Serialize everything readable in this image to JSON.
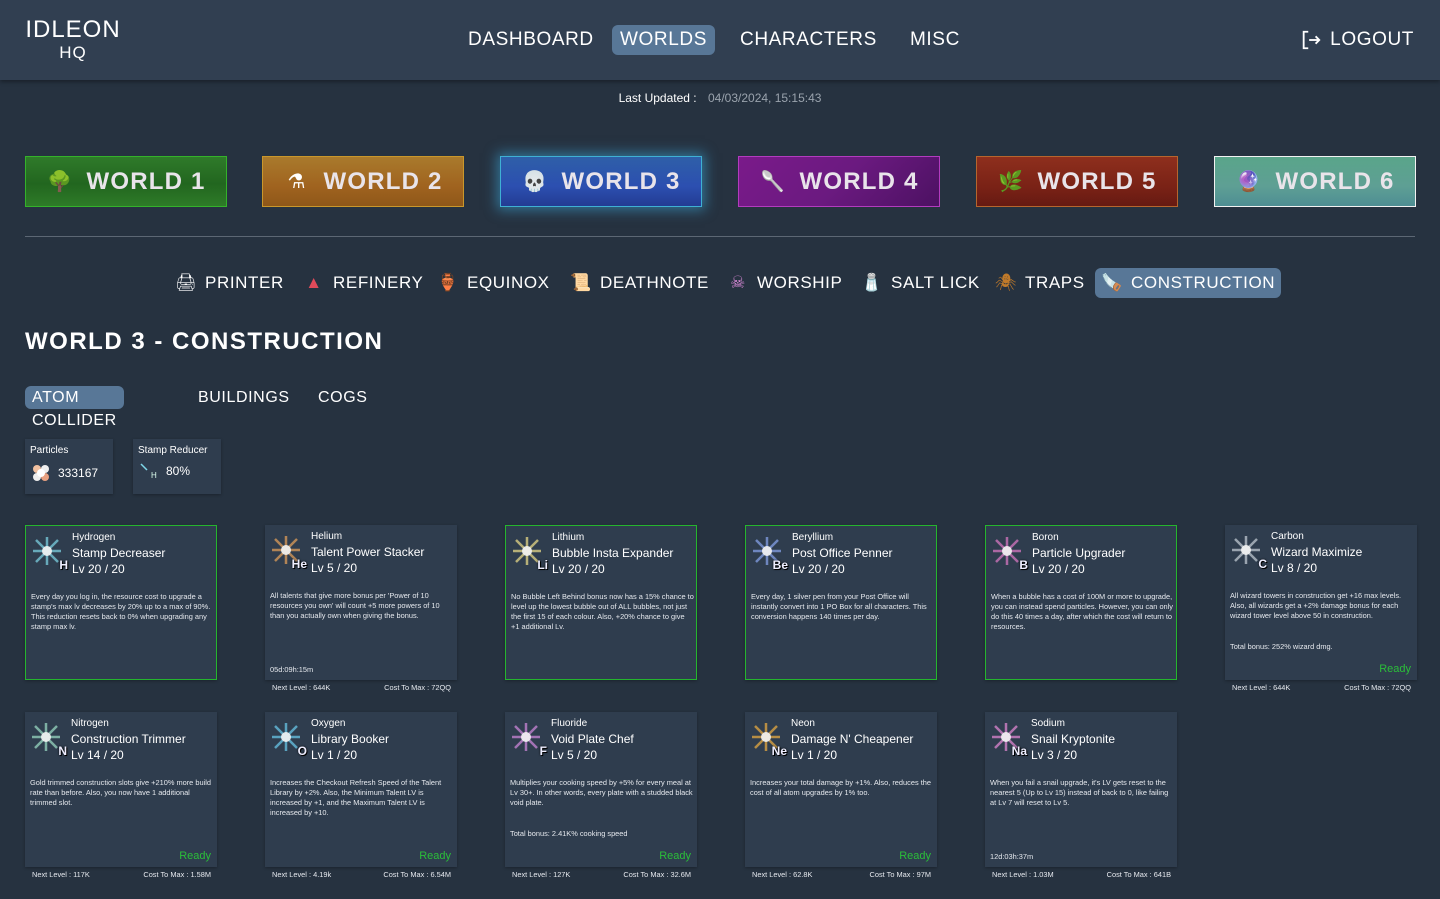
{
  "header": {
    "logo_line1": "IDLEON",
    "logo_line2": "HQ",
    "nav": [
      {
        "label": "DASHBOARD",
        "active": false
      },
      {
        "label": "WORLDS",
        "active": true
      },
      {
        "label": "CHARACTERS",
        "active": false
      },
      {
        "label": "MISC",
        "active": false
      }
    ],
    "logout_label": "LOGOUT",
    "logout_icon": "logout-icon"
  },
  "last_updated": {
    "label": "Last Updated :",
    "value": "04/03/2024, 15:15:43"
  },
  "worlds": [
    {
      "label": "WORLD 1",
      "icon": "tree-anvil-icon",
      "active": false
    },
    {
      "label": "WORLD 2",
      "icon": "alchemy-icon",
      "active": false
    },
    {
      "label": "WORLD 3",
      "icon": "saw-skull-icon",
      "active": true
    },
    {
      "label": "WORLD 4",
      "icon": "ladle-icon",
      "active": false
    },
    {
      "label": "WORLD 5",
      "icon": "sprout-icon",
      "active": false
    },
    {
      "label": "WORLD 6",
      "icon": "orb-icon",
      "active": false
    }
  ],
  "subnav": [
    {
      "label": "PRINTER",
      "icon": "printer-icon",
      "active": false
    },
    {
      "label": "REFINERY",
      "icon": "refinery-icon",
      "active": false
    },
    {
      "label": "EQUINOX",
      "icon": "equinox-icon",
      "active": false
    },
    {
      "label": "DEATHNOTE",
      "icon": "deathnote-icon",
      "active": false
    },
    {
      "label": "WORSHIP",
      "icon": "worship-skull-icon",
      "active": false
    },
    {
      "label": "SALT LICK",
      "icon": "salt-lick-icon",
      "active": false
    },
    {
      "label": "TRAPS",
      "icon": "spider-icon",
      "active": false
    },
    {
      "label": "CONSTRUCTION",
      "icon": "saw-icon",
      "active": true
    }
  ],
  "page_title": "WORLD 3 - CONSTRUCTION",
  "tabs": [
    {
      "label": "ATOM COLLIDER",
      "active": true
    },
    {
      "label": "BUILDINGS",
      "active": false
    },
    {
      "label": "COGS",
      "active": false
    }
  ],
  "stats": [
    {
      "label": "Particles",
      "value": "333167",
      "icon": "particles-icon"
    },
    {
      "label": "Stamp Reducer",
      "value": "80%",
      "icon": "hydrogen-icon"
    }
  ],
  "atoms": [
    {
      "element": "Hydrogen",
      "symbol": "H",
      "name": "Stamp Decreaser",
      "level": "Lv 20 / 20",
      "maxed": true,
      "color": "#7fd8e8",
      "description": "Every day you log in, the resource cost to upgrade a stamp's max lv decreases by 20% up to a max of 90%. This reduction resets back to 0% when upgrading any stamp max lv.",
      "extra": "",
      "timer": "",
      "ready": "",
      "next_level": "",
      "cost_to_max": ""
    },
    {
      "element": "Helium",
      "symbol": "He",
      "name": "Talent Power Stacker",
      "level": "Lv 5 / 20",
      "maxed": false,
      "color": "#e8a35a",
      "description": "All talents that give more bonus per 'Power of 10 resources you own' will count +5 more powers of 10 than you actually own when giving the bonus.",
      "extra": "",
      "timer": "05d:09h:15m",
      "ready": "",
      "next_level": "Next Level : 644K",
      "cost_to_max": "Cost To Max : 72QQ"
    },
    {
      "element": "Lithium",
      "symbol": "Li",
      "name": "Bubble Insta Expander",
      "level": "Lv 20 / 20",
      "maxed": true,
      "color": "#f0e08a",
      "description": "No Bubble Left Behind bonus now has a 15% chance to level up the lowest bubble out of ALL bubbles, not just the first 15 of each colour. Also, +20% chance to give +1 additional Lv.",
      "extra": "",
      "timer": "",
      "ready": "",
      "next_level": "",
      "cost_to_max": ""
    },
    {
      "element": "Beryllium",
      "symbol": "Be",
      "name": "Post Office Penner",
      "level": "Lv 20 / 20",
      "maxed": true,
      "color": "#8aa6f0",
      "description": "Every day, 1 silver pen from your Post Office will instantly convert into 1 PO Box for all characters. This conversion happens 140 times per day.",
      "extra": "",
      "timer": "",
      "ready": "",
      "next_level": "",
      "cost_to_max": ""
    },
    {
      "element": "Boron",
      "symbol": "B",
      "name": "Particle Upgrader",
      "level": "Lv 20 / 20",
      "maxed": true,
      "color": "#e07ac8",
      "description": "When a bubble has a cost of 100M or more to upgrade, you can instead spend particles. However, you can only do this 40 times a day, after which the cost will return to resources.",
      "extra": "",
      "timer": "",
      "ready": "",
      "next_level": "",
      "cost_to_max": ""
    },
    {
      "element": "Carbon",
      "symbol": "C",
      "name": "Wizard Maximize",
      "level": "Lv 8 / 20",
      "maxed": false,
      "color": "#c8d0d8",
      "description": "All wizard towers in construction get +16 max levels. Also, all wizards get a +2% damage bonus for each wizard tower level above 50 in construction.",
      "extra": "Total bonus: 252% wizard dmg.",
      "timer": "",
      "ready": "Ready",
      "next_level": "Next Level : 644K",
      "cost_to_max": "Cost To Max : 72QQ"
    },
    {
      "element": "Nitrogen",
      "symbol": "N",
      "name": "Construction Trimmer",
      "level": "Lv 14 / 20",
      "maxed": false,
      "color": "#9fe0c8",
      "description": "Gold trimmed construction slots give +210% more build rate than before. Also, you now have 1 additional trimmed slot.",
      "extra": "",
      "timer": "",
      "ready": "Ready",
      "next_level": "Next Level : 117K",
      "cost_to_max": "Cost To Max : 1.58M"
    },
    {
      "element": "Oxygen",
      "symbol": "O",
      "name": "Library Booker",
      "level": "Lv 1 / 20",
      "maxed": false,
      "color": "#6ccdf0",
      "description": "Increases the Checkout Refresh Speed of the Talent Library by +2%. Also, the Minimum Talent LV is increased by +1, and the Maximum Talent LV is increased by +10.",
      "extra": "",
      "timer": "",
      "ready": "Ready",
      "next_level": "Next Level : 4.19k",
      "cost_to_max": "Cost To Max : 6.54M"
    },
    {
      "element": "Fluoride",
      "symbol": "F",
      "name": "Void Plate Chef",
      "level": "Lv 5 / 20",
      "maxed": false,
      "color": "#d48ae0",
      "description": "Multiplies your cooking speed by +5% for every meal at Lv 30+. In other words, every plate with a studded black void plate.",
      "extra": "Total bonus: 2.41K% cooking speed",
      "timer": "",
      "ready": "Ready",
      "next_level": "Next Level : 127K",
      "cost_to_max": "Cost To Max : 32.6M"
    },
    {
      "element": "Neon",
      "symbol": "Ne",
      "name": "Damage N' Cheapener",
      "level": "Lv 1 / 20",
      "maxed": false,
      "color": "#f0b040",
      "description": "Increases your total damage by +1%. Also, reduces the cost of all atom upgrades by 1% too.",
      "extra": "",
      "timer": "",
      "ready": "Ready",
      "next_level": "Next Level : 62.8K",
      "cost_to_max": "Cost To Max : 97M"
    },
    {
      "element": "Sodium",
      "symbol": "Na",
      "name": "Snail Kryptonite",
      "level": "Lv 3 / 20",
      "maxed": false,
      "color": "#e88ad8",
      "description": "When you fail a snail upgrade, it's LV gets reset to the nearest 5 (Up to Lv 15) instead of back to 0, like failing at Lv 7 will reset to Lv 5.",
      "extra": "",
      "timer": "12d:03h:37m",
      "ready": "",
      "next_level": "Next Level : 1.03M",
      "cost_to_max": "Cost To Max : 641B"
    }
  ]
}
